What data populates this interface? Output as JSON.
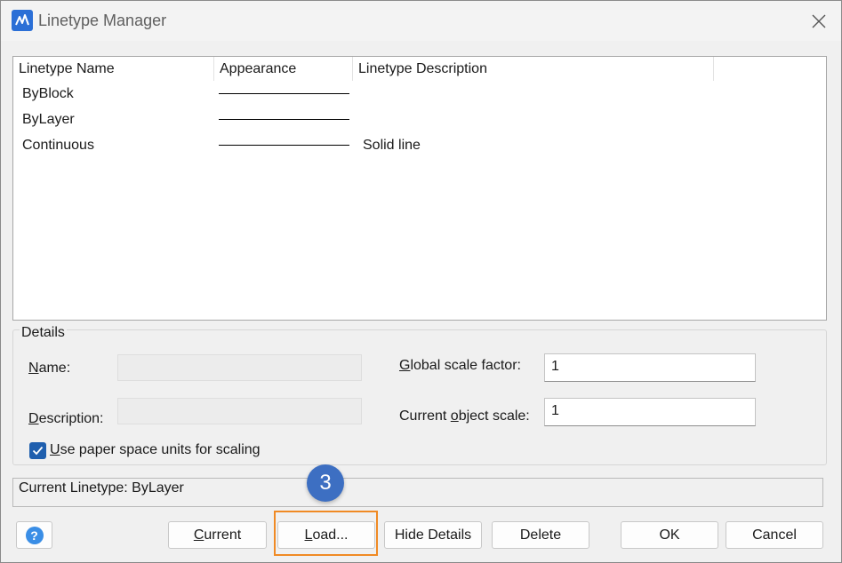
{
  "window": {
    "title": "Linetype Manager"
  },
  "list": {
    "columns": [
      "Linetype Name",
      "Appearance",
      "Linetype Description"
    ],
    "rows": [
      {
        "name": "ByBlock",
        "description": ""
      },
      {
        "name": "ByLayer",
        "description": ""
      },
      {
        "name": "Continuous",
        "description": "Solid line"
      }
    ]
  },
  "details": {
    "legend": "Details",
    "name_label_u": "N",
    "name_label_rest": "ame:",
    "name_value": "",
    "description_label_u": "D",
    "description_label_rest": "escription:",
    "description_value": "",
    "global_scale_label_u": "G",
    "global_scale_label_rest": "lobal scale factor:",
    "global_scale_value": "1",
    "object_scale_label_pre": "Current ",
    "object_scale_label_u": "o",
    "object_scale_label_rest": "bject scale:",
    "object_scale_value": "1",
    "paper_space_label_u": "U",
    "paper_space_label_rest": "se paper space units for scaling",
    "paper_space_checked": true
  },
  "status": {
    "current_linetype": "Current Linetype: ByLayer"
  },
  "buttons": {
    "help": "?",
    "current_u": "C",
    "current_rest": "urrent",
    "load_u": "L",
    "load_rest": "oad...",
    "hide_details": "Hide Details",
    "delete": "Delete",
    "ok": "OK",
    "cancel": "Cancel"
  },
  "annotation": {
    "step": "3"
  },
  "colors": {
    "accent": "#1f5fae",
    "highlight": "#f08a24",
    "badge": "#3d6fc2",
    "help_icon": "#3a8ee6"
  }
}
